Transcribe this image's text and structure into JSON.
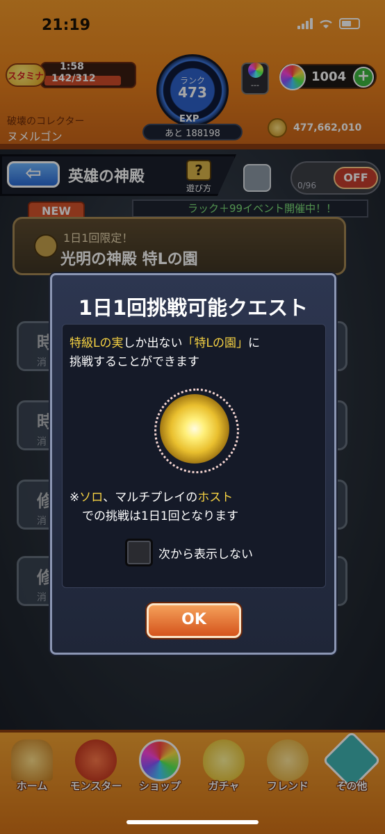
{
  "status_bar": {
    "time": "21:19"
  },
  "header": {
    "stamina_label": "スタミナ",
    "stamina_timer": "1:58",
    "stamina_value": "142/312",
    "rank_label": "ランク",
    "rank_value": "473",
    "exp_label": "EXP",
    "exp_remaining": "あと 188198",
    "capsule_text": "---",
    "orb_count": "1004",
    "title": "破壊のコレクター",
    "player_name": "ヌメルゴン",
    "coins": "477,662,010"
  },
  "nav": {
    "title": "英雄の神殿",
    "help_label": "遊び方",
    "counter": "0/96",
    "toggle": "OFF"
  },
  "event_banner": "ラック＋99イベント開催中！！",
  "quest": {
    "new_tag": "NEW",
    "limit": "1日1回限定！",
    "title": "光明の神殿 特Lの園"
  },
  "modal": {
    "title": "1日1回挑戦可能クエスト",
    "desc_hl1": "特級Lの実",
    "desc_part1": "しか出ない",
    "desc_hl2": "「特Lの園」",
    "desc_part2": "に",
    "desc_line2": "挑戦することができます",
    "note_prefix": "※",
    "note_hl1": "ソロ",
    "note_part1": "、マルチプレイの",
    "note_hl2": "ホスト",
    "note_line2": "での挑戦は1日1回となります",
    "checkbox_label": "次から表示しない",
    "ok_label": "OK"
  },
  "bottom_nav": [
    "ホーム",
    "モンスター",
    "ショップ",
    "ガチャ",
    "フレンド",
    "その他"
  ],
  "colors": {
    "accent": "#e7801c",
    "highlight": "#f7d343",
    "ok_button": "#d4541c"
  }
}
